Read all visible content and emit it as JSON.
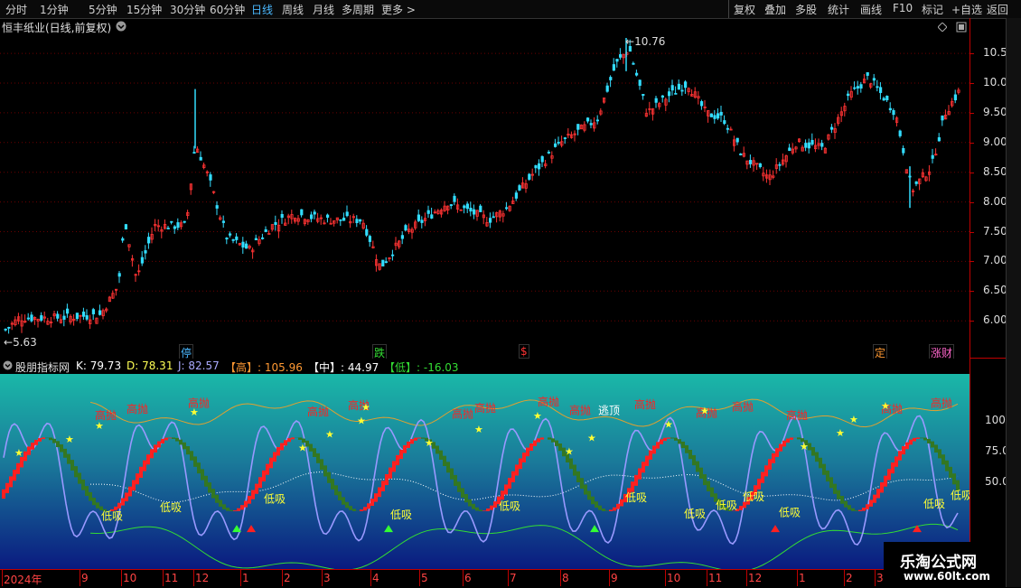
{
  "toolbar": {
    "periods": [
      "分时",
      "1分钟",
      "5分钟",
      "15分钟",
      "30分钟",
      "60分钟",
      "日线",
      "周线",
      "月线",
      "多周期",
      "更多"
    ],
    "active_period": "日线",
    "more_arrow": ">",
    "right_buttons": [
      "复权",
      "叠加",
      "多股",
      "统计",
      "画线",
      "F10",
      "标记",
      "+自选",
      "返回"
    ]
  },
  "stock": {
    "title": "恒丰纸业(日线,前复权)",
    "dropdown_icon": "circle-chevron-down-icon",
    "high_label": "10.76",
    "low_label": "5.63",
    "price_ticks": [
      "10.50",
      "10.00",
      "9.50",
      "9.00",
      "8.50",
      "8.00",
      "7.50",
      "7.00",
      "6.50",
      "6.00"
    ],
    "event_markers": [
      {
        "text": "停",
        "color": "#4ab8ff"
      },
      {
        "text": "跌",
        "color": "#33dd33"
      },
      {
        "text": "$",
        "color": "#ff3333"
      },
      {
        "text": "定",
        "color": "#ff9933"
      },
      {
        "text": "涨财",
        "color": "#ff66cc"
      }
    ],
    "diamond_icon": "diamond-icon",
    "square_icon": "window-square-icon"
  },
  "indicator": {
    "name": "股朋指标网",
    "K": {
      "label": "K: 79.73",
      "color": "#ffffff"
    },
    "D": {
      "label": "D: 78.31",
      "color": "#ffff55"
    },
    "J": {
      "label": "J: 82.57",
      "color": "#aaaaff"
    },
    "high": {
      "label": "【高】: 105.96",
      "color": "#ff9933"
    },
    "mid": {
      "label": "【中】: 44.97",
      "color": "#ffffff"
    },
    "low": {
      "label": "【低】: -16.03",
      "color": "#33dd33"
    },
    "y_ticks": [
      "100.0",
      "75.00",
      "50.00"
    ],
    "signal_buy": "低吸",
    "signal_sell": "高抛",
    "signal_escape": "逃顶"
  },
  "time_axis": [
    "2024年",
    "9",
    "10",
    "11",
    "12",
    "1",
    "2",
    "3",
    "4",
    "5",
    "6",
    "7",
    "8",
    "9",
    "10",
    "11",
    "12",
    "1",
    "2",
    "3"
  ],
  "watermark": {
    "title": "乐淘公式网",
    "url": "www.60lt.com"
  },
  "colors": {
    "up": "#ff3333",
    "down": "#33ddff",
    "grid": "#8b0000",
    "axis": "#c00000"
  }
}
